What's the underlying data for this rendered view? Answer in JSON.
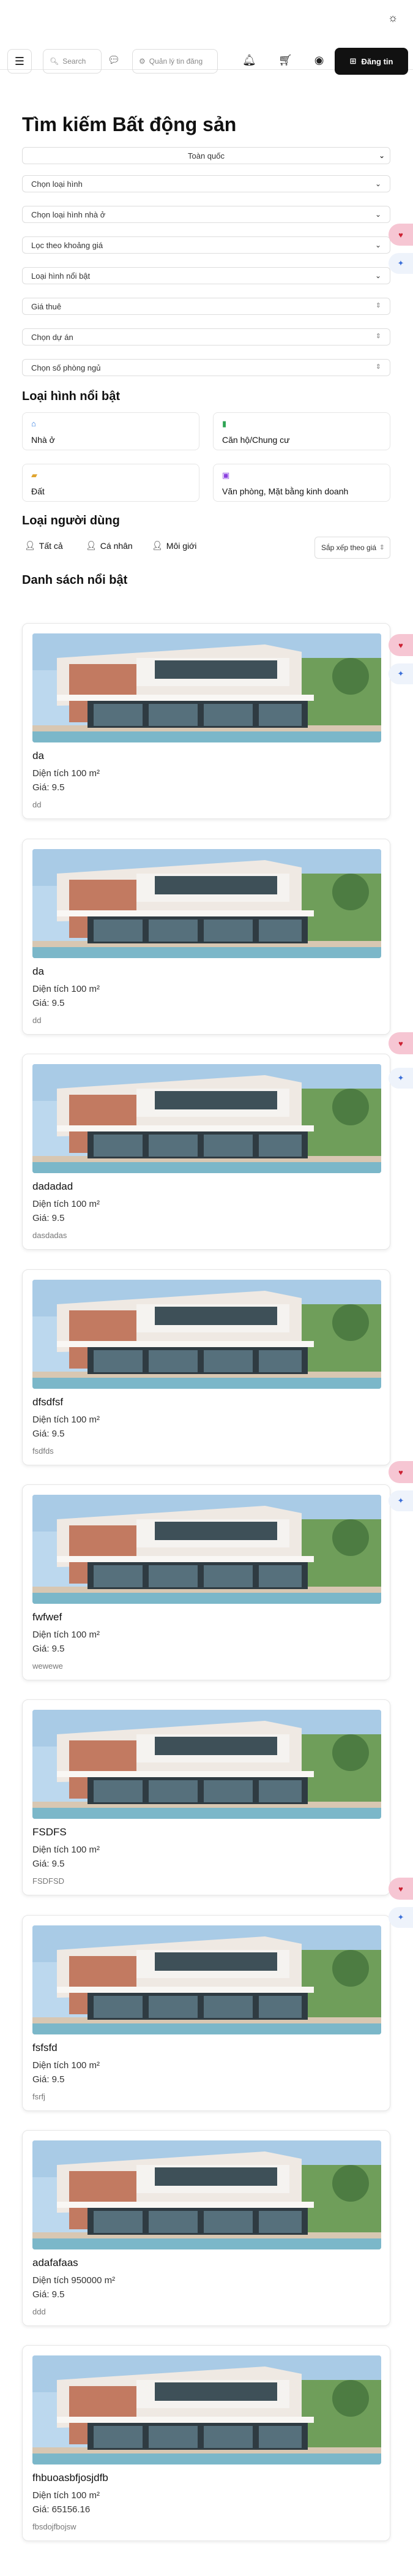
{
  "nav": {
    "search_placeholder": "Search",
    "admin_placeholder": "Quản lý tin đăng",
    "post_label": "Đăng tin",
    "icons": [
      "menu-icon",
      "search-icon",
      "chat-icon",
      "bell-icon",
      "cart-icon",
      "user-icon",
      "plus-square-icon",
      "sun-icon"
    ]
  },
  "page": {
    "title": "Tìm kiếm Bất động sản",
    "filters": [
      "Toàn quốc",
      "Chọn loại hình",
      "Chọn loại hình nhà ở",
      "Lọc theo khoảng giá",
      "Loại hình nổi bật",
      "Giá thuê",
      "Chọn dự án",
      "Chọn số phòng ngủ"
    ],
    "featured_types_title": "Loại hình nổi bật",
    "featured_types": [
      "Nhà ở",
      "Căn hộ/Chung cư",
      "Đất",
      "Văn phòng, Mặt bằng kinh doanh"
    ],
    "user_type_title": "Loại người dùng",
    "user_types": [
      "Tất cả",
      "Cá nhân",
      "Môi giới"
    ],
    "sort_label": "Sắp xếp theo giá",
    "listing_title": "Danh sách nổi bật"
  },
  "listings": [
    {
      "name": "da",
      "area": "Diện tích 100 m²",
      "price": "Giá: 9.5",
      "desc": "dd"
    },
    {
      "name": "da",
      "area": "Diện tích 100 m²",
      "price": "Giá: 9.5",
      "desc": "dd"
    },
    {
      "name": "dadadad",
      "area": "Diện tích 100 m²",
      "price": "Giá: 9.5",
      "desc": "dasdadas"
    },
    {
      "name": "dfsdfsf",
      "area": "Diện tích 100 m²",
      "price": "Giá: 9.5",
      "desc": "fsdfds"
    },
    {
      "name": "fwfwef",
      "area": "Diện tích 100 m²",
      "price": "Giá: 9.5",
      "desc": "wewewe"
    },
    {
      "name": "FSDFS",
      "area": "Diện tích 100 m²",
      "price": "Giá: 9.5",
      "desc": "FSDFSD"
    },
    {
      "name": "fsfsfd",
      "area": "Diện tích 100 m²",
      "price": "Giá: 9.5",
      "desc": "fsrfj"
    },
    {
      "name": "adafafaas",
      "area": "Diện tích 950000 m²",
      "price": "Giá: 9.5",
      "desc": "ddd"
    },
    {
      "name": "fhbuoasbfjosjdfb",
      "area": "Diện tích 100 m²",
      "price": "Giá: 65156.16",
      "desc": "fbsdojfbojsw"
    }
  ]
}
